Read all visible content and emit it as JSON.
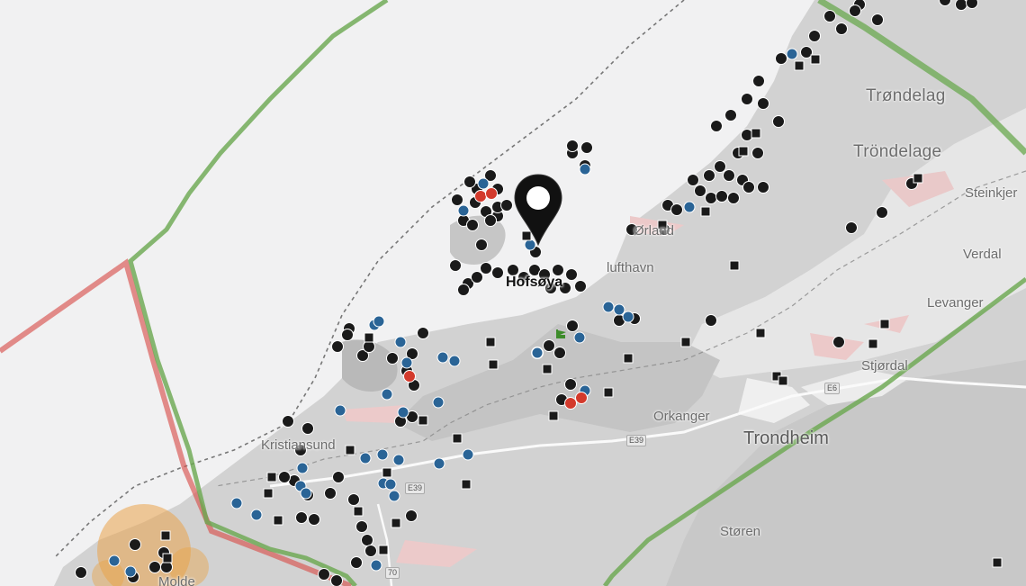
{
  "map": {
    "selected_place": "Hofsøya",
    "labels": {
      "trondelag": "Trøndelag",
      "trondelag_alt": "Tröndelage",
      "steinkjer": "Steinkjer",
      "verdal": "Verdal",
      "levanger": "Levanger",
      "stjordal": "Stjørdal",
      "lufthavn": "lufthavn",
      "orkanger": "Orkanger",
      "trondheim": "Trondheim",
      "storen": "Støren",
      "kristiansund": "Kristiansund",
      "molde": "Molde",
      "orland": "Ørland"
    },
    "roads": {
      "e6": "E6",
      "e39_east": "E39",
      "e39_west": "E39",
      "r70": "70"
    },
    "colors": {
      "water": "#f1f1f2",
      "land": "#cfcfcf",
      "county_border": "#6aa84f",
      "region_border": "#d9534f",
      "marker_black": "#1a1a1a",
      "marker_blue": "#2a6496",
      "marker_red": "#d33a2c",
      "heat_orange": "#e9a34a",
      "pin": "#111111"
    },
    "legend_markers": [
      "black-circle",
      "blue-circle",
      "red-circle",
      "black-square",
      "map-pin",
      "green-flag"
    ]
  }
}
